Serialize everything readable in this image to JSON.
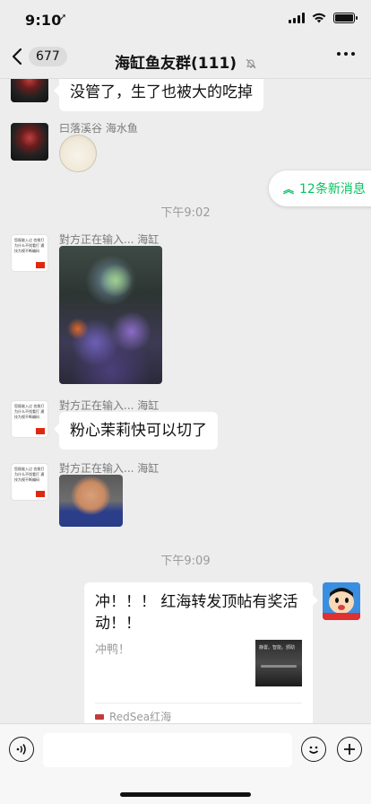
{
  "status_bar": {
    "time": "9:10",
    "location_arrow": "➚"
  },
  "nav": {
    "back_count": "677",
    "title": "海缸鱼友群(111)"
  },
  "new_messages": {
    "label": "12条新消息",
    "icon": "double-chevron-up-icon"
  },
  "messages": {
    "m1_text": "没管了，生了也被大的吃掉",
    "m2_sender": "曰落溪谷 海水鱼",
    "time1": "下午9:02",
    "m3_sender": "對方正在输入... 海缸",
    "m4_sender": "對方正在输入... 海缸",
    "m4_text": "粉心茉莉快可以切了",
    "m5_sender": "對方正在输入... 海缸",
    "time2": "下午9:09"
  },
  "avatar_text": "您既能入过 也拨打 为什么不找看打 通技为视不断编码",
  "card": {
    "title": "冲！！！ 红海转发顶帖有奖活动！！",
    "desc": "冲鸭！",
    "thumb_text": "静置。智能。颁助",
    "source": "RedSea红海"
  },
  "colors": {
    "accent": "#07c160",
    "bg": "#ededed"
  }
}
